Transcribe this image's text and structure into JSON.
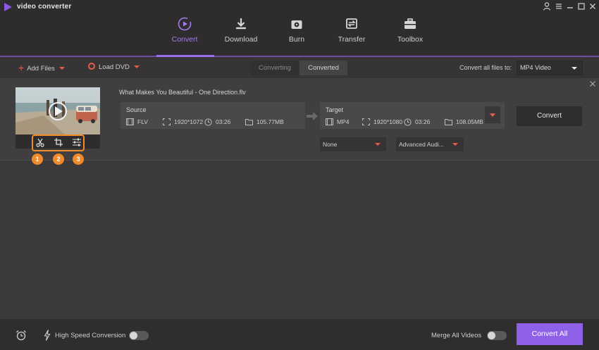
{
  "app": {
    "title": "video converter"
  },
  "window_controls": [
    "user-icon",
    "menu-icon",
    "minimize-icon",
    "maximize-icon",
    "close-icon"
  ],
  "nav": {
    "items": [
      {
        "label": "Convert",
        "icon": "convert-icon",
        "active": true
      },
      {
        "label": "Download",
        "icon": "download-icon",
        "active": false
      },
      {
        "label": "Burn",
        "icon": "burn-icon",
        "active": false
      },
      {
        "label": "Transfer",
        "icon": "transfer-icon",
        "active": false
      },
      {
        "label": "Toolbox",
        "icon": "toolbox-icon",
        "active": false
      }
    ]
  },
  "toolbar": {
    "add_files": "Add Files",
    "load_dvd": "Load DVD",
    "tab_converting": "Converting",
    "tab_converted": "Converted",
    "convert_all_label": "Convert all files to:",
    "convert_all_format": "MP4 Video"
  },
  "file": {
    "name": "What Makes You Beautiful - One Direction.flv",
    "tool_badges": [
      "1",
      "2",
      "3"
    ],
    "source": {
      "title": "Source",
      "format": "FLV",
      "resolution": "1920*1072",
      "duration": "03:26",
      "size": "105.77MB"
    },
    "target": {
      "title": "Target",
      "format": "MP4",
      "resolution": "1920*1080",
      "duration": "03:26",
      "size": "108.05MB"
    },
    "convert_label": "Convert",
    "subtitle_select": "None",
    "audio_select": "Advanced Audi..."
  },
  "bottom": {
    "high_speed_label": "High Speed Conversion",
    "high_speed_on": false,
    "merge_label": "Merge All Videos",
    "merge_on": false,
    "convert_all_label": "Convert All"
  },
  "colors": {
    "accent": "#9b6ff2",
    "accent_button": "#8f61e8",
    "highlight_orange": "#f08a2a",
    "caret_red": "#e65d4c"
  }
}
